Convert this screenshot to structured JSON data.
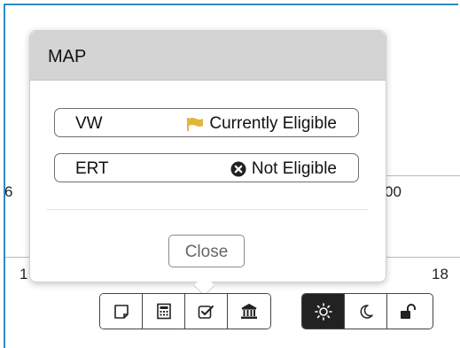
{
  "background": {
    "left_value": "6",
    "right_value": "00",
    "axis_left": "1",
    "axis_right": "18"
  },
  "popover": {
    "title": "MAP",
    "items": [
      {
        "label": "VW",
        "status": "Currently Eligible",
        "icon": "flag-icon",
        "icon_color": "#e3b53a"
      },
      {
        "label": "ERT",
        "status": "Not Eligible",
        "icon": "x-circle-icon",
        "icon_color": "#222222"
      }
    ],
    "close_label": "Close"
  },
  "toolbar": {
    "left_group": [
      "note-icon",
      "calculator-icon",
      "checkbox-icon",
      "bank-icon"
    ],
    "right_group": [
      "sun-icon",
      "moon-icon",
      "unlock-icon"
    ],
    "active": "sun-icon"
  }
}
